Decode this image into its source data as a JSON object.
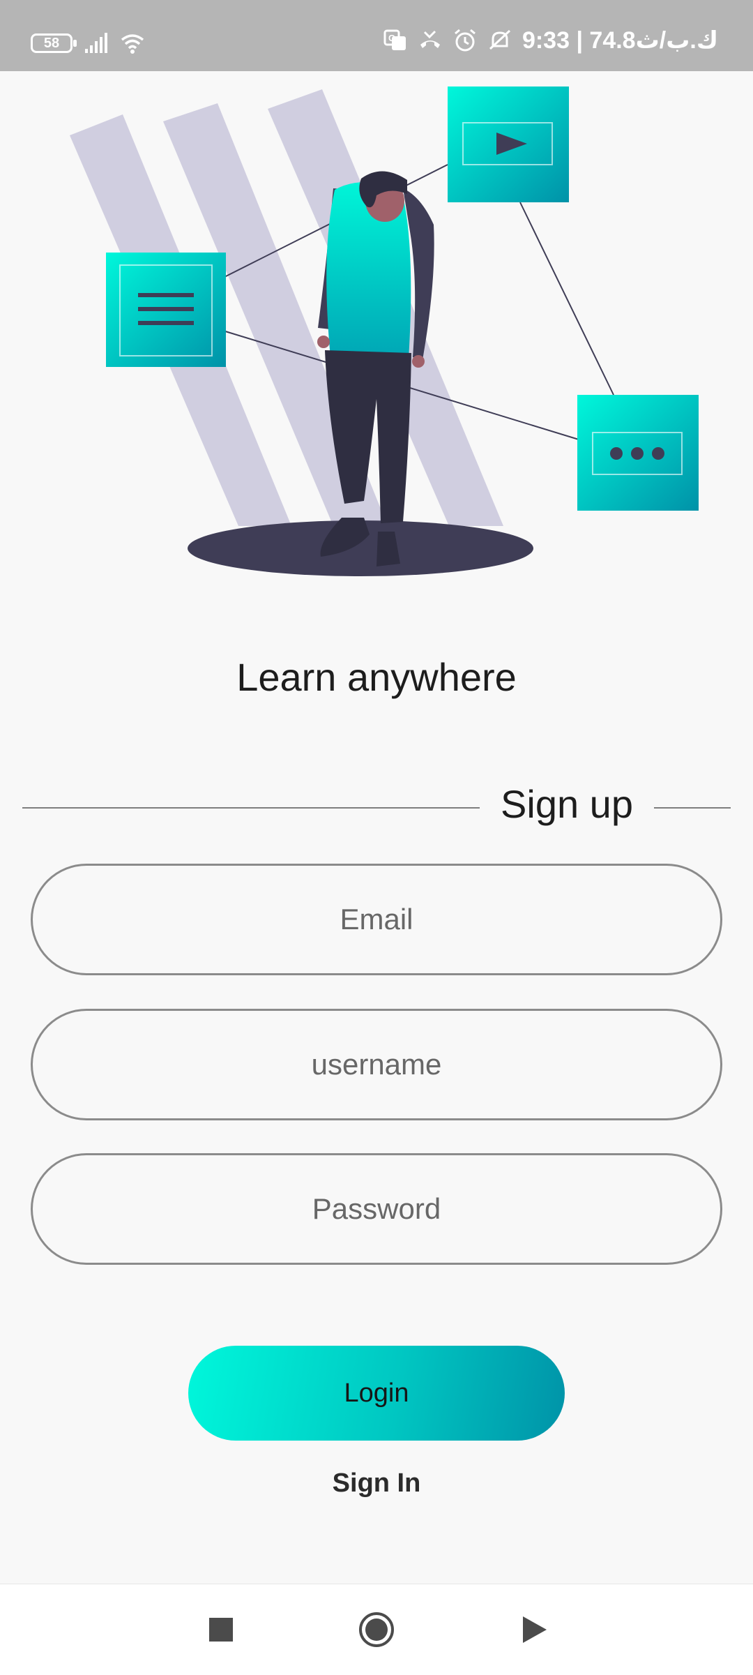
{
  "status_bar": {
    "battery_level": "58",
    "time_text": "ك.ب/ث74.8 | 9:33",
    "icons": [
      "battery-icon",
      "signal-icon",
      "wifi-icon",
      "translate-icon",
      "missed-call-icon",
      "alarm-icon",
      "mute-icon"
    ]
  },
  "hero": {
    "illustration": "person-with-floating-media-cards",
    "card_icons": [
      "menu-icon",
      "play-icon",
      "more-dots-icon"
    ],
    "accent_color": "#00e6d2",
    "stripe_color": "#d0cee0",
    "shadow_color": "#3f3d56"
  },
  "headline": "Learn anywhere",
  "signup": {
    "title": "Sign up",
    "email_placeholder": "Email",
    "username_placeholder": "username",
    "password_placeholder": "Password",
    "login_label": "Login",
    "sign_in_label": "Sign In"
  },
  "nav_bar": {
    "buttons": [
      "recents-square-icon",
      "home-circle-icon",
      "back-triangle-icon"
    ]
  }
}
